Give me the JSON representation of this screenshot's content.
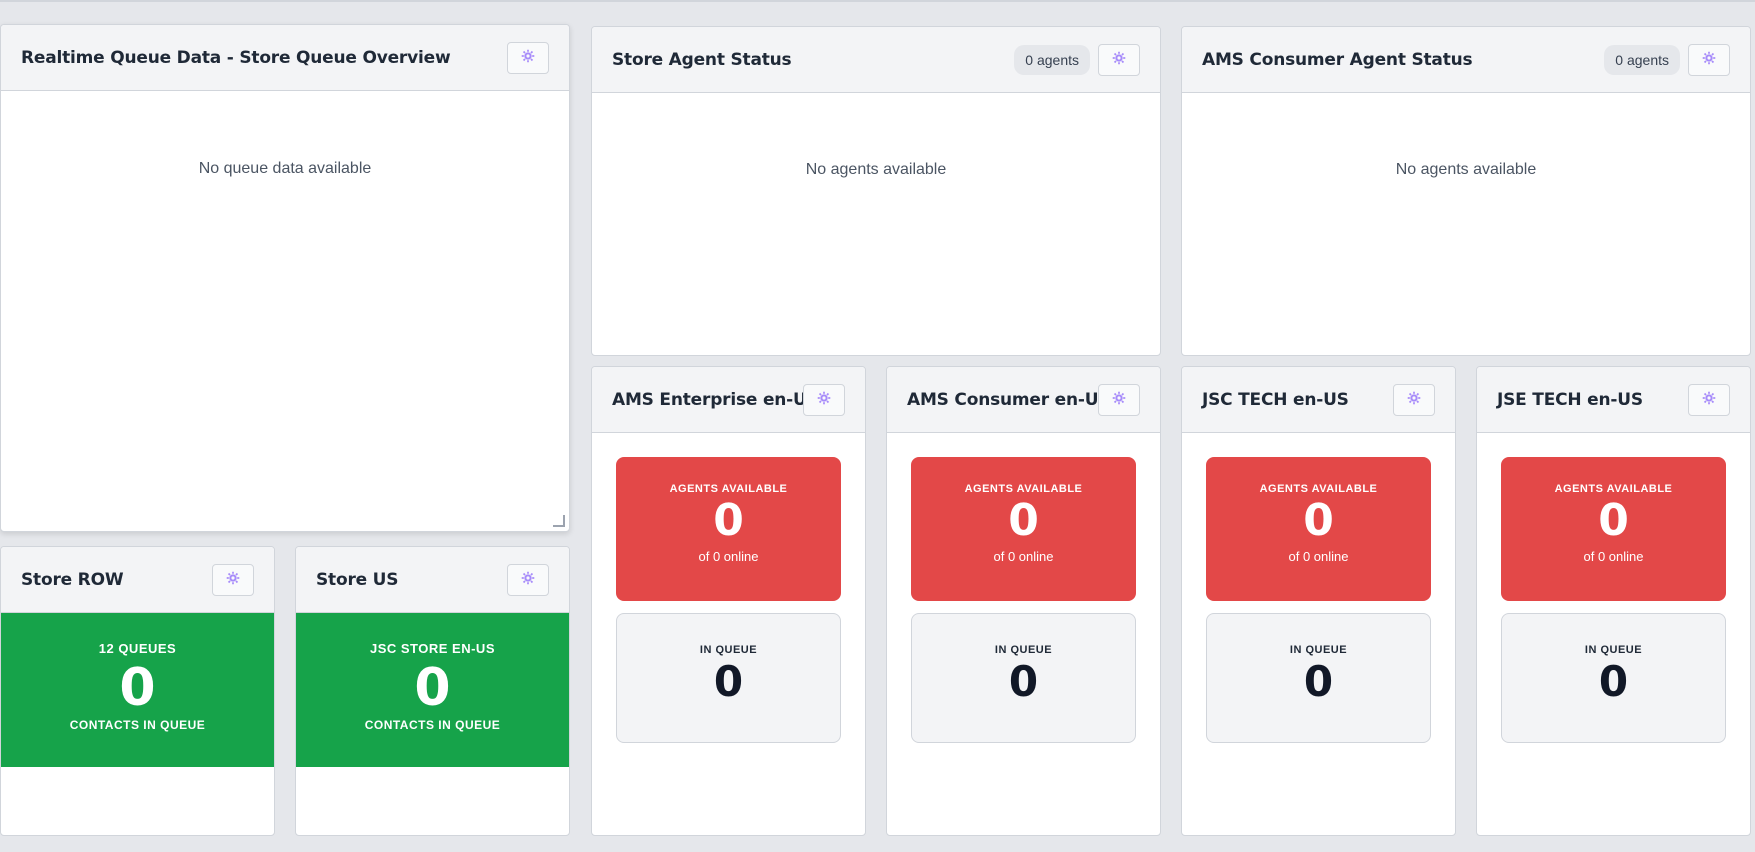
{
  "theme": {
    "green": "#16a34a",
    "red": "#e34848",
    "gear_color": "#a78bfa"
  },
  "queue_overview": {
    "title": "Realtime Queue Data - Store Queue Overview",
    "empty_message": "No queue data available",
    "settings_icon": "gear-icon"
  },
  "store_agent_status": {
    "title": "Store Agent Status",
    "badge": "0 agents",
    "empty_message": "No agents available"
  },
  "ams_consumer_agent_status": {
    "title": "AMS Consumer Agent Status",
    "badge": "0 agents",
    "empty_message": "No agents available"
  },
  "store_row": {
    "title": "Store ROW",
    "top_label": "12 QUEUES",
    "count": "0",
    "bottom_label": "CONTACTS IN QUEUE"
  },
  "store_us": {
    "title": "Store US",
    "top_label": "JSC STORE EN-US",
    "count": "0",
    "bottom_label": "CONTACTS IN QUEUE"
  },
  "queues": [
    {
      "title": "AMS Enterprise en-US",
      "agents_label": "AGENTS AVAILABLE",
      "agents": "0",
      "online": "of 0 online",
      "queue_label": "IN QUEUE",
      "in_queue": "0"
    },
    {
      "title": "AMS Consumer en-US",
      "agents_label": "AGENTS AVAILABLE",
      "agents": "0",
      "online": "of 0 online",
      "queue_label": "IN QUEUE",
      "in_queue": "0"
    },
    {
      "title": "JSC TECH en-US",
      "agents_label": "AGENTS AVAILABLE",
      "agents": "0",
      "online": "of 0 online",
      "queue_label": "IN QUEUE",
      "in_queue": "0"
    },
    {
      "title": "JSE TECH en-US",
      "agents_label": "AGENTS AVAILABLE",
      "agents": "0",
      "online": "of 0 online",
      "queue_label": "IN QUEUE",
      "in_queue": "0"
    }
  ]
}
